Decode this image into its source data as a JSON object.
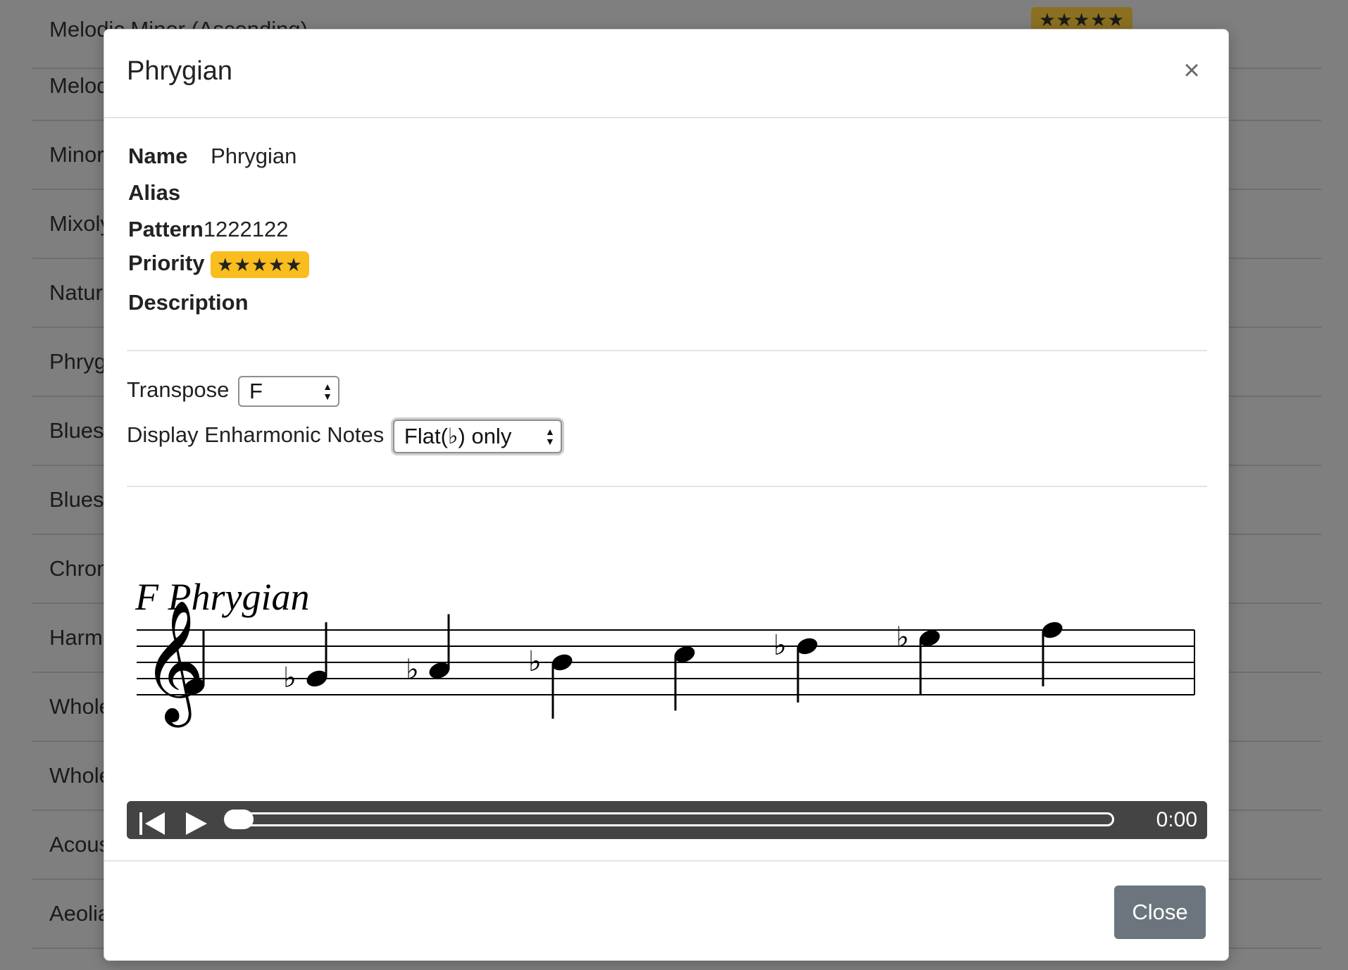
{
  "background_list": {
    "rows": [
      {
        "label": "Melodic Minor (Ascending)",
        "badge": "★★★★★"
      },
      {
        "label": "Melod"
      },
      {
        "label": "Minor"
      },
      {
        "label": "Mixoly"
      },
      {
        "label": "Natura"
      },
      {
        "label": "Phryg"
      },
      {
        "label": "Blues"
      },
      {
        "label": "Blues"
      },
      {
        "label": "Chron"
      },
      {
        "label": "Harm"
      },
      {
        "label": "Whole"
      },
      {
        "label": "Whole"
      },
      {
        "label": "Acous"
      },
      {
        "label": "Aeolia"
      }
    ]
  },
  "modal": {
    "title": "Phrygian",
    "close_icon": "×",
    "info": {
      "name_label": "Name",
      "name_value": "Phrygian",
      "alias_label": "Alias",
      "alias_value": "",
      "pattern_label": "Pattern",
      "pattern_value": "1222122",
      "priority_label": "Priority",
      "priority_value": "★★★★★",
      "description_label": "Description",
      "description_value": ""
    },
    "controls": {
      "transpose_label": "Transpose",
      "transpose_value": "F",
      "enharmonic_label": "Display Enharmonic Notes",
      "enharmonic_value": "Flat(♭) only"
    },
    "score": {
      "title": "F Phrygian",
      "clef": "treble-clef",
      "notes": [
        {
          "name": "F",
          "accidental": ""
        },
        {
          "name": "G",
          "accidental": "♭"
        },
        {
          "name": "A",
          "accidental": "♭"
        },
        {
          "name": "B",
          "accidental": "♭"
        },
        {
          "name": "C",
          "accidental": ""
        },
        {
          "name": "D",
          "accidental": "♭"
        },
        {
          "name": "E",
          "accidental": "♭"
        },
        {
          "name": "F",
          "accidental": ""
        }
      ]
    },
    "player": {
      "rewind_icon": "skip-back-icon",
      "play_icon": "play-icon",
      "progress": 0,
      "time": "0:00"
    },
    "footer": {
      "close_label": "Close"
    }
  }
}
